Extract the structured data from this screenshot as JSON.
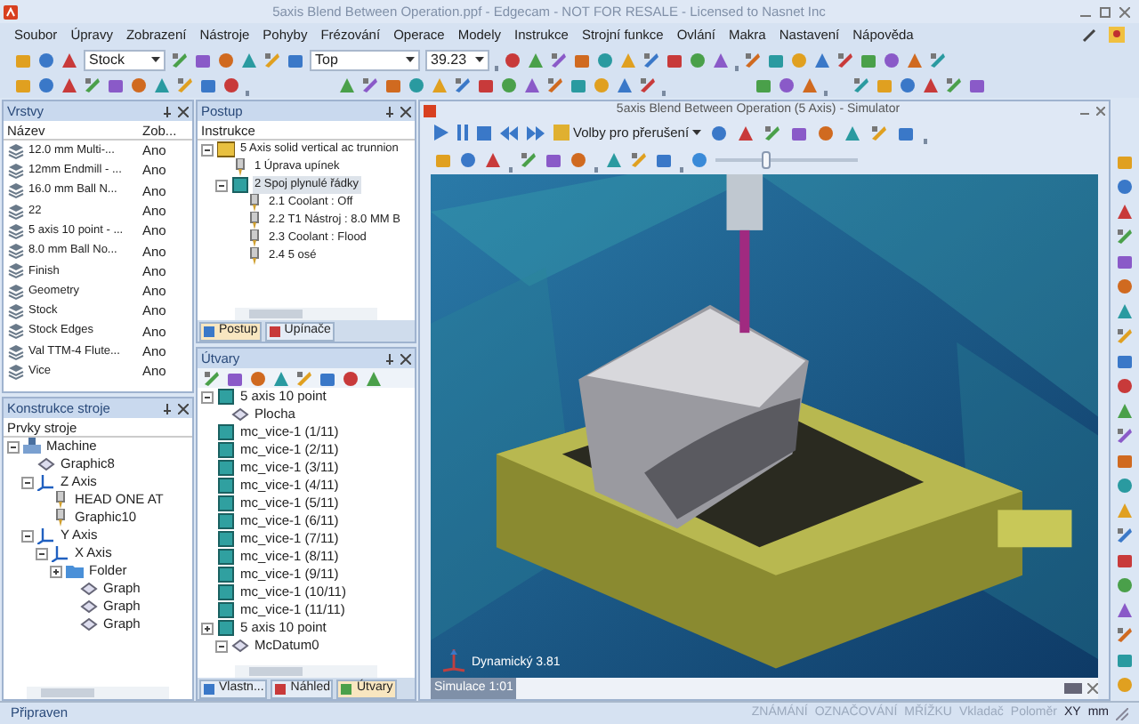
{
  "window": {
    "title": "5axis Blend Between Operation.ppf - Edgecam - NOT FOR RESALE - Licensed to Nasnet Inc"
  },
  "menu": [
    "Soubor",
    "Úpravy",
    "Zobrazení",
    "Nástroje",
    "Pohyby",
    "Frézování",
    "Operace",
    "Modely",
    "Instrukce",
    "Strojní funkce",
    "Ovlání",
    "Makra",
    "Nastavení",
    "Nápověda"
  ],
  "toolbar": {
    "stock_combo": "Stock",
    "view_combo": "Top",
    "value_combo": "39.23"
  },
  "layers_panel": {
    "title": "Vrstvy",
    "columns": [
      "Název",
      "Zob..."
    ],
    "rows": [
      {
        "name": "12.0 mm Multi-...",
        "shown": "Ano"
      },
      {
        "name": "12mm Endmill - ...",
        "shown": "Ano"
      },
      {
        "name": "16.0 mm Ball N...",
        "shown": "Ano"
      },
      {
        "name": "22",
        "shown": "Ano"
      },
      {
        "name": "5 axis 10 point - ...",
        "shown": "Ano"
      },
      {
        "name": "8.0 mm Ball No...",
        "shown": "Ano"
      },
      {
        "name": "Finish",
        "shown": "Ano"
      },
      {
        "name": "Geometry",
        "shown": "Ano"
      },
      {
        "name": "Stock",
        "shown": "Ano"
      },
      {
        "name": "Stock Edges",
        "shown": "Ano"
      },
      {
        "name": "Val TTM-4 Flute...",
        "shown": "Ano"
      },
      {
        "name": "Vice",
        "shown": "Ano"
      }
    ]
  },
  "process_panel": {
    "title": "Postup",
    "header": "Instrukce",
    "tree": [
      {
        "label": "5 Axis solid vertical ac trunnion",
        "selected": false,
        "expanded": true,
        "children": [
          {
            "label": "1 Úprava upínek",
            "selected": false
          },
          {
            "label": "2 Spoj plynulé řádky",
            "selected": true,
            "expanded": true,
            "children": [
              {
                "label": "2.1 Coolant : Off",
                "selected": false
              },
              {
                "label": "2.2 T1 Nástroj : 8.0 MM B",
                "selected": false
              },
              {
                "label": "2.3 Coolant : Flood",
                "selected": false
              },
              {
                "label": "2.4 5 osé",
                "selected": false
              }
            ]
          }
        ]
      }
    ],
    "tabs": [
      {
        "label": "Postup",
        "selected": true
      },
      {
        "label": "Upínače",
        "selected": false
      }
    ]
  },
  "machine_panel": {
    "title": "Konstrukce stroje",
    "header": "Prvky stroje",
    "tree": [
      {
        "label": "Machine",
        "expanded": true,
        "children": [
          {
            "label": "Graphic8"
          },
          {
            "label": "Z Axis",
            "expanded": true,
            "children": [
              {
                "label": "HEAD ONE AT"
              },
              {
                "label": "Graphic10"
              }
            ]
          },
          {
            "label": "Y Axis",
            "expanded": true,
            "children": [
              {
                "label": "X Axis",
                "expanded": true,
                "children": [
                  {
                    "label": "Folder",
                    "expanded": false,
                    "children": [
                      {
                        "label": "Graph"
                      },
                      {
                        "label": "Graph"
                      },
                      {
                        "label": "Graph"
                      }
                    ]
                  }
                ]
              }
            ]
          }
        ]
      }
    ]
  },
  "features_panel": {
    "title": "Útvary",
    "tree": [
      {
        "label": "5 axis 10 point",
        "expanded": true,
        "children": [
          {
            "label": "Plocha"
          }
        ]
      },
      {
        "label": "mc_vice-1 (1/11)"
      },
      {
        "label": "mc_vice-1 (2/11)"
      },
      {
        "label": "mc_vice-1 (3/11)"
      },
      {
        "label": "mc_vice-1 (4/11)"
      },
      {
        "label": "mc_vice-1 (5/11)"
      },
      {
        "label": "mc_vice-1 (6/11)"
      },
      {
        "label": "mc_vice-1 (7/11)"
      },
      {
        "label": "mc_vice-1 (8/11)"
      },
      {
        "label": "mc_vice-1 (9/11)"
      },
      {
        "label": "mc_vice-1 (10/11)"
      },
      {
        "label": "mc_vice-1 (11/11)"
      },
      {
        "label": "5 axis 10 point",
        "expanded": false,
        "children": [
          {
            "label": "McDatum0",
            "expanded": true
          }
        ]
      }
    ],
    "tabs": [
      {
        "label": "Vlastn...",
        "selected": false
      },
      {
        "label": "Náhled",
        "selected": false
      },
      {
        "label": "Útvary",
        "selected": true
      }
    ]
  },
  "simulator": {
    "title": "5axis Blend Between Operation (5 Axis) - Simulator",
    "break_options": "Volby pro přerušení",
    "speed_slider": {
      "level": 0.35
    },
    "viewport_label": "Dynamický 3.81",
    "footer": "Simulace 1:01"
  },
  "status_bar": {
    "left": "Připraven",
    "indicators": [
      "ZNÁMÁNÍ",
      "OZNAČOVÁNÍ",
      "MŘÍŽKU",
      "Vkladač",
      "Poloměr",
      "XY",
      "mm"
    ]
  }
}
